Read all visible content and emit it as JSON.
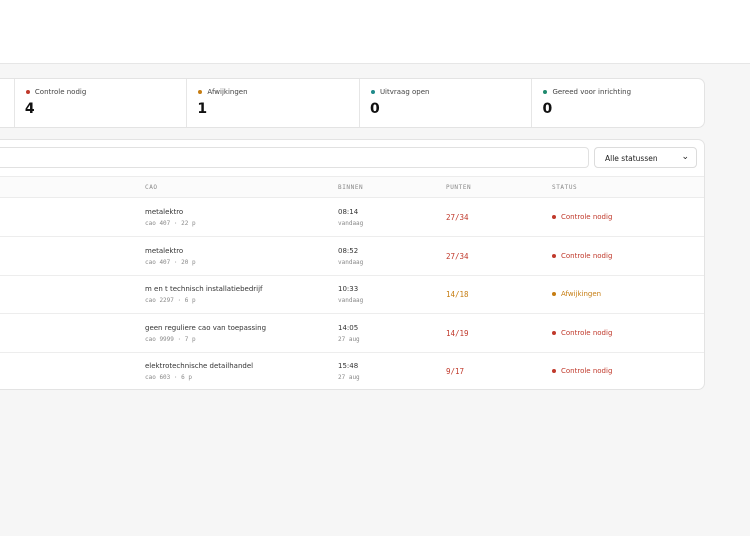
{
  "colors": {
    "controle": "#c0392b",
    "afwijkingen": "#c67d12",
    "uitvraag": "#1f8a8a",
    "gereed": "#1f8a6e"
  },
  "stats": [
    {
      "label": "Controle nodig",
      "value": "4",
      "dot": "#c0392b"
    },
    {
      "label": "Afwijkingen",
      "value": "1",
      "dot": "#c67d12"
    },
    {
      "label": "Uitvraag open",
      "value": "0",
      "dot": "#1f8a8a"
    },
    {
      "label": "Gereed voor inrichting",
      "value": "0",
      "dot": "#1f8a6e"
    }
  ],
  "filter": {
    "status_select": "Alle statussen"
  },
  "table": {
    "headers": {
      "cao": "CAO",
      "binnen": "BINNEN",
      "punten": "PUNTEN",
      "status": "STATUS"
    },
    "rows": [
      {
        "cao": "metalektro",
        "sub": "cao 407 · 22 p",
        "time": "08:14",
        "day": "vandaag",
        "punten": "27/34",
        "status": "Controle nodig",
        "color": "#c0392b"
      },
      {
        "cao": "metalektro",
        "sub": "cao 407 · 20 p",
        "time": "08:52",
        "day": "vandaag",
        "punten": "27/34",
        "status": "Controle nodig",
        "color": "#c0392b"
      },
      {
        "cao": "m en t technisch installatiebedrijf",
        "sub": "cao 2297 · 6 p",
        "time": "10:33",
        "day": "vandaag",
        "punten": "14/18",
        "status": "Afwijkingen",
        "color": "#c67d12"
      },
      {
        "cao": "geen reguliere cao van toepassing",
        "sub": "cao 9999 · 7 p",
        "time": "14:05",
        "day": "27 aug",
        "punten": "14/19",
        "status": "Controle nodig",
        "color": "#c0392b"
      },
      {
        "cao": "elektrotechnische detailhandel",
        "sub": "cao 603 · 6 p",
        "time": "15:48",
        "day": "27 aug",
        "punten": "9/17",
        "status": "Controle nodig",
        "color": "#c0392b"
      }
    ]
  }
}
